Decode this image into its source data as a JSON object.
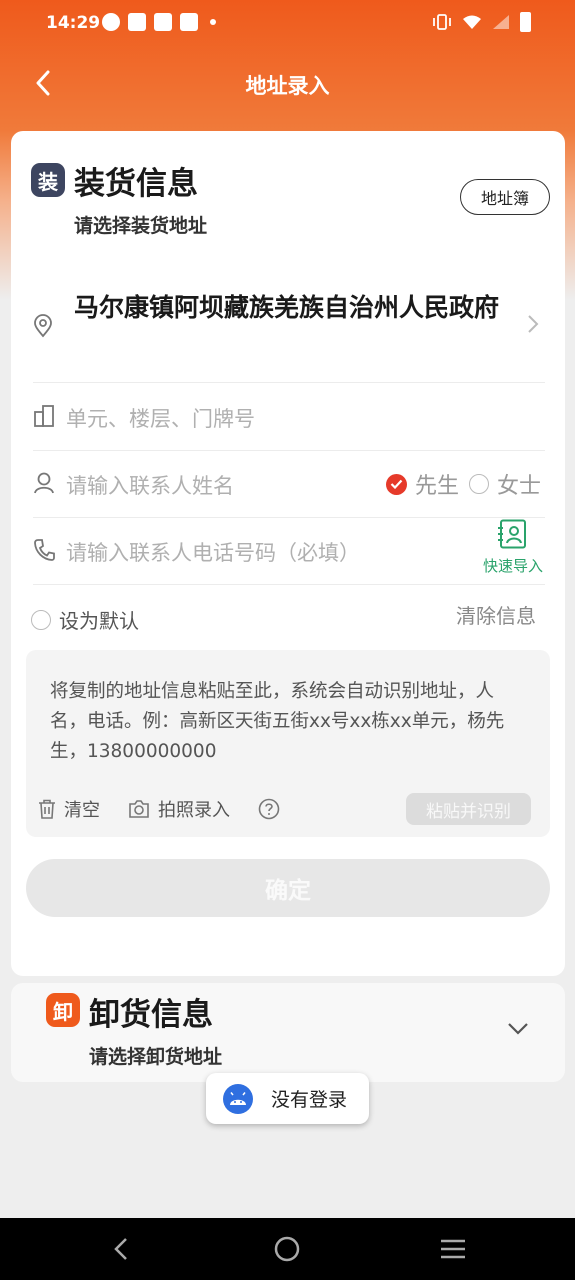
{
  "status_bar": {
    "time": "14:29"
  },
  "header": {
    "title": "地址录入"
  },
  "loading": {
    "badge": "装",
    "title": "装货信息",
    "subtitle": "请选择装货地址",
    "address_book": "地址簿",
    "address": "马尔康镇阿坝藏族羌族自治州人民政府",
    "unit_placeholder": "单元、楼层、门牌号",
    "name_placeholder": "请输入联系人姓名",
    "gender_male": "先生",
    "gender_female": "女士",
    "phone_placeholder": "请输入联系人电话号码（必填）",
    "quick_import": "快速导入",
    "set_default": "设为默认",
    "clear_info": "清除信息",
    "paste_hint": "将复制的地址信息粘贴至此，系统会自动识别地址，人名，电话。例：高新区天街五街xx号xx栋xx单元，杨先生，13800000000",
    "clear": "清空",
    "photo_input": "拍照录入",
    "paste_recognize": "粘贴并识别",
    "confirm": "确定"
  },
  "unloading": {
    "badge": "卸",
    "title": "卸货信息",
    "subtitle": "请选择卸货地址"
  },
  "toast": {
    "text": "没有登录"
  },
  "colors": {
    "accent": "#ef5a1c",
    "green": "#2aa36b",
    "red": "#e63a2a"
  }
}
